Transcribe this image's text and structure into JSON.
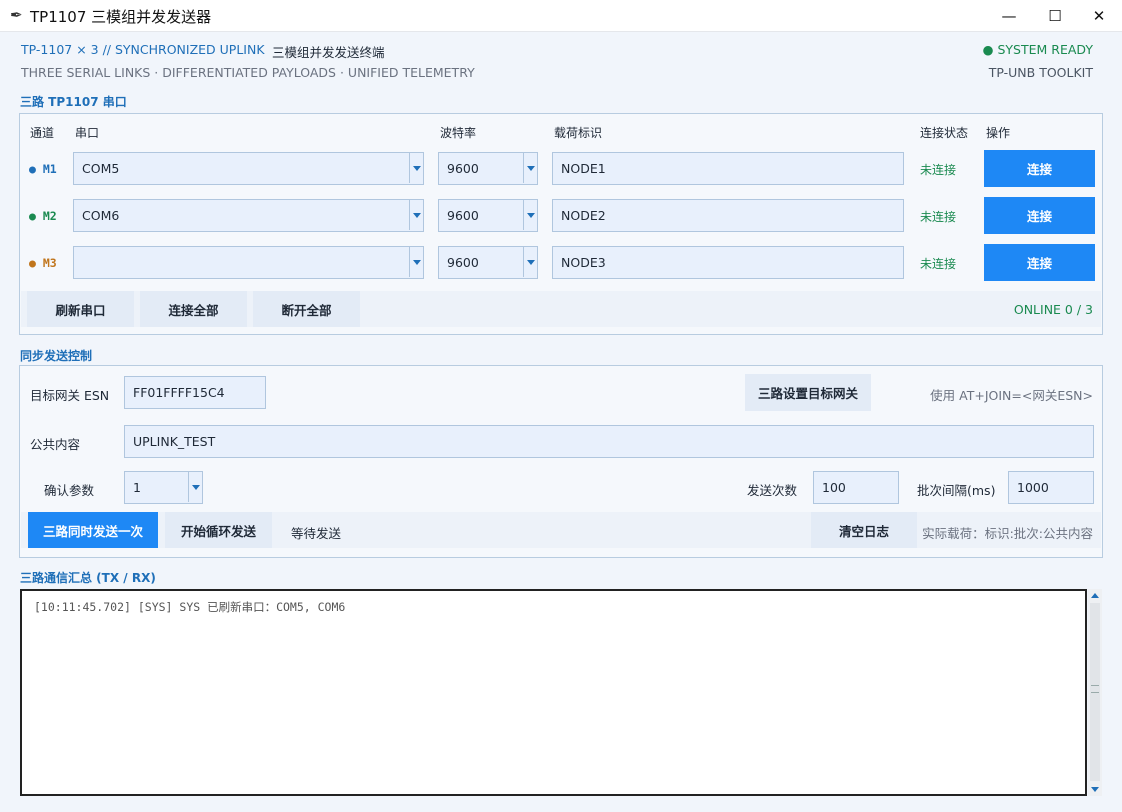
{
  "window": {
    "title": "TP1107 三模组并发发送器",
    "app_icon": "feather-icon",
    "min_glyph": "—",
    "max_glyph": "☐",
    "close_glyph": "✕"
  },
  "header": {
    "line1a": "TP-1107 × 3 // SYNCHRONIZED UPLINK",
    "line1b": "三模组并发发送终端",
    "line2": "THREE SERIAL LINKS · DIFFERENTIATED PAYLOADS · UNIFIED TELEMETRY",
    "status": "● SYSTEM READY",
    "toolkit": "TP-UNB TOOLKIT"
  },
  "ports": {
    "title": "三路 TP1107 串口",
    "columns": {
      "channel": "通道",
      "port": "串口",
      "baud": "波特率",
      "payload": "载荷标识",
      "state": "连接状态",
      "action": "操作"
    },
    "rows": [
      {
        "channel": "● M1",
        "channel_color": "#1f6fb8",
        "port": "COM5",
        "baud": "9600",
        "payload": "NODE1",
        "state": "未连接",
        "action": "连接"
      },
      {
        "channel": "● M2",
        "channel_color": "#1a8a50",
        "port": "COM6",
        "baud": "9600",
        "payload": "NODE2",
        "state": "未连接",
        "action": "连接"
      },
      {
        "channel": "● M3",
        "channel_color": "#c0751c",
        "port": "",
        "baud": "9600",
        "payload": "NODE3",
        "state": "未连接",
        "action": "连接"
      }
    ],
    "buttons": {
      "refresh": "刷新串口",
      "connect_all": "连接全部",
      "disconnect_all": "断开全部"
    },
    "online": "ONLINE 0 / 3"
  },
  "sync": {
    "title": "同步发送控制",
    "esn_label": "目标网关 ESN",
    "esn_value": "FF01FFFF15C4",
    "set_gateway_button": "三路设置目标网关",
    "hint": "使用 AT+JOIN=<网关ESN>",
    "content_label": "公共内容",
    "content_value": "UPLINK_TEST",
    "confirm_label": "确认参数",
    "confirm_value": "1",
    "count_label": "发送次数",
    "count_value": "100",
    "interval_label": "批次间隔(ms)",
    "interval_value": "1000",
    "send_once_button": "三路同时发送一次",
    "loop_button": "开始循环发送",
    "status": "等待发送",
    "clear_button": "清空日志",
    "payload_hint": "实际载荷：标识:批次:公共内容"
  },
  "log": {
    "title": "三路通信汇总 (TX / RX)",
    "lines": [
      "[10:11:45.702] [SYS] SYS 已刷新串口：COM5, COM6"
    ]
  },
  "colors": {
    "accent": "#1e88f5",
    "title_blue": "#1f6fb8",
    "ready_green": "#1a8a50"
  }
}
